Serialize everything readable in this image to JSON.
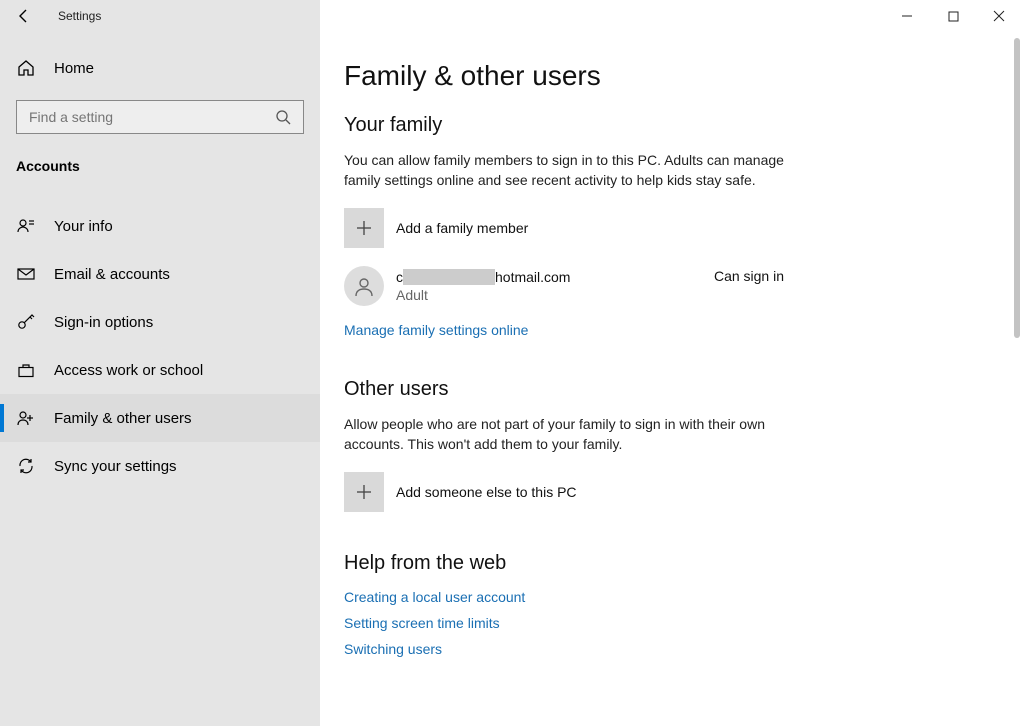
{
  "window": {
    "title": "Settings"
  },
  "sidebar": {
    "home_label": "Home",
    "search_placeholder": "Find a setting",
    "category": "Accounts",
    "items": [
      {
        "label": "Your info",
        "icon": "user-info-icon"
      },
      {
        "label": "Email & accounts",
        "icon": "mail-icon"
      },
      {
        "label": "Sign-in options",
        "icon": "key-icon"
      },
      {
        "label": "Access work or school",
        "icon": "briefcase-icon"
      },
      {
        "label": "Family & other users",
        "icon": "people-icon"
      },
      {
        "label": "Sync your settings",
        "icon": "sync-icon"
      }
    ],
    "selected_index": 4
  },
  "page": {
    "title": "Family & other users",
    "family": {
      "heading": "Your family",
      "description": "You can allow family members to sign in to this PC. Adults can manage family settings online and see recent activity to help kids stay safe.",
      "add_label": "Add a family member",
      "account": {
        "email_prefix": "c",
        "email_suffix": "hotmail.com",
        "role": "Adult",
        "status": "Can sign in"
      },
      "manage_link": "Manage family settings online"
    },
    "other": {
      "heading": "Other users",
      "description": "Allow people who are not part of your family to sign in with their own accounts. This won't add them to your family.",
      "add_label": "Add someone else to this PC"
    },
    "help": {
      "heading": "Help from the web",
      "links": [
        "Creating a local user account",
        "Setting screen time limits",
        "Switching users"
      ]
    }
  }
}
